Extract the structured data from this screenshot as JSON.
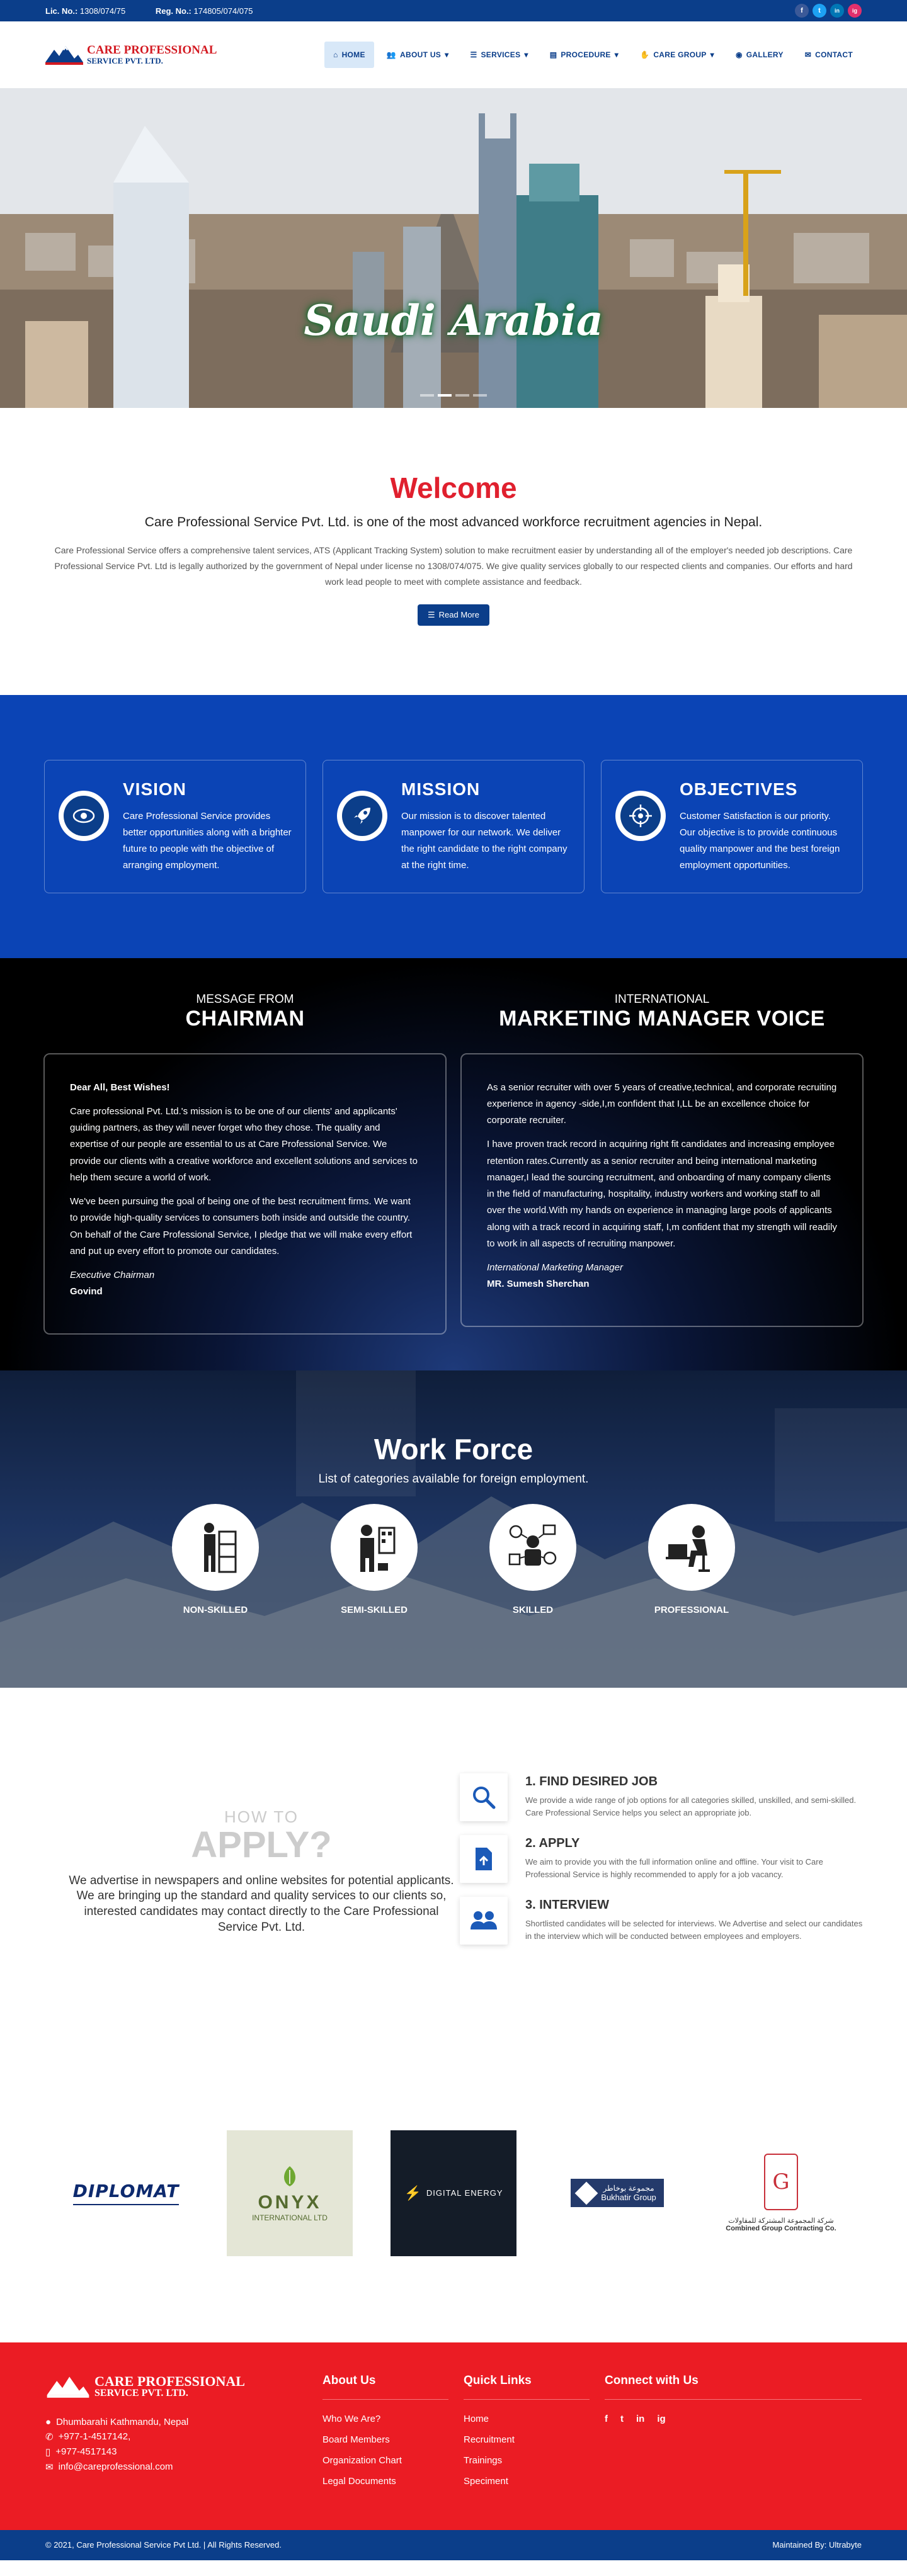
{
  "topbar": {
    "lic_label": "Lic. No.:",
    "lic_value": "1308/074/75",
    "reg_label": "Reg. No.:",
    "reg_value": "174805/074/075",
    "social": [
      "f",
      "t",
      "in",
      "ig"
    ]
  },
  "brand": {
    "line1": "CARE PROFESSIONAL",
    "line2": "SERVICE PVT. LTD."
  },
  "nav": {
    "items": [
      "HOME",
      "ABOUT US",
      "SERVICES",
      "PROCEDURE",
      "CARE GROUP",
      "GALLERY",
      "CONTACT"
    ]
  },
  "hero": {
    "caption": "Saudi Arabia"
  },
  "welcome": {
    "title": "Welcome",
    "subtitle": "Care Professional Service Pvt. Ltd. is one of the most advanced workforce recruitment agencies in Nepal.",
    "body": "Care Professional Service offers a comprehensive talent services, ATS (Applicant Tracking System) solution to make recruitment easier by understanding all of the employer's needed job descriptions. Care Professional Service Pvt. Ltd is legally authorized by the government of Nepal under license no 1308/074/075. We give quality services globally to our respected clients and companies. Our efforts and hard work lead people to meet with complete assistance and feedback.",
    "button": "Read More"
  },
  "vmo": [
    {
      "title": "VISION",
      "text": "Care Professional Service provides better opportunities along with a brighter future to people with the objective of arranging employment."
    },
    {
      "title": "MISSION",
      "text": "Our mission is to discover talented manpower for our network. We deliver the right candidate to the right company at the right time."
    },
    {
      "title": "OBJECTIVES",
      "text": "Customer Satisfaction is our priority. Our objective is to provide continuous quality manpower and the best foreign employment opportunities."
    }
  ],
  "chairman": {
    "small": "MESSAGE FROM",
    "big": "CHAIRMAN",
    "greeting": "Dear All, Best Wishes!",
    "p1": "Care professional Pvt. Ltd.'s mission is to be one of our clients' and applicants' guiding partners, as they will never forget who they chose. The quality and expertise of our people are essential to us at Care Professional Service. We provide our clients with a creative workforce and excellent solutions and services to help them secure a world of work.",
    "p2": "We've been pursuing the goal of being one of the best recruitment firms. We want to provide high-quality services to consumers both inside and outside the country. On behalf of the Care Professional Service, I pledge that we will make every effort and put up every effort to promote our candidates.",
    "role": "Executive Chairman",
    "name": "Govind"
  },
  "manager": {
    "small": "INTERNATIONAL",
    "big": "MARKETING MANAGER VOICE",
    "p1": "As a senior recruiter with over 5 years of creative,technical, and corporate recruiting experience in agency -side,I,m confident that I,LL be an excellence choice for corporate recruiter.",
    "p2": "I have proven track record in acquiring right fit candidates and increasing employee retention rates.Currently as a senior recruiter and being international marketing manager,I lead the sourcing recruitment, and onboarding of many company clients in the field of manufacturing, hospitality, industry workers and working staff to all over the world.With my hands on experience in managing large pools of applicants along with a track record in acquiring staff, I,m confident that my strength will readily to work in all aspects of recruiting manpower.",
    "role": "International Marketing Manager",
    "name": "MR. Sumesh Sherchan"
  },
  "workforce": {
    "title": "Work Force",
    "subtitle": "List of categories available for foreign employment.",
    "categories": [
      "NON-SKILLED",
      "SEMI-SKILLED",
      "SKILLED",
      "PROFESSIONAL"
    ]
  },
  "apply": {
    "how": "HOW TO",
    "big": "APPLY?",
    "text": "We advertise in newspapers and online websites for potential applicants. We are bringing up the standard and quality services to our clients so, interested candidates may contact directly to the Care Professional Service Pvt. Ltd.",
    "steps": [
      {
        "title": "1. FIND DESIRED JOB",
        "text": "We provide a wide range of job options for all categories skilled, unskilled, and semi-skilled. Care Professional Service helps you select an appropriate job."
      },
      {
        "title": "2. APPLY",
        "text": "We aim to provide you with the full information online and offline. Your visit to Care Professional Service is highly recommended to apply for a job vacancy."
      },
      {
        "title": "3. INTERVIEW",
        "text": "Shortlisted candidates will be selected for interviews. We Advertise and select our candidates in the interview which will be conducted between employees and employers."
      }
    ]
  },
  "partners": {
    "diplomat": "DIPLOMAT",
    "onyx1": "ONYX",
    "onyx2": "INTERNATIONAL LTD",
    "digital": "DIGITAL ENERGY",
    "bukhatir_ar": "مجموعة بوخاطر",
    "bukhatir": "Bukhatir Group",
    "combined_ar": "شركة المجموعة المشتركة للمقاولات",
    "combined": "Combined Group Contracting Co."
  },
  "footer": {
    "address": "Dhumbarahi Kathmandu, Nepal",
    "phone1": "+977-1-4517142,",
    "phone2": "+977-4517143",
    "email": "info@careprofessional.com",
    "about_title": "About Us",
    "about_links": [
      "Who We Are?",
      "Board Members",
      "Organization Chart",
      "Legal Documents"
    ],
    "quick_title": "Quick Links",
    "quick_links": [
      "Home",
      "Recruitment",
      "Trainings",
      "Speciment"
    ],
    "connect_title": "Connect with Us",
    "connect_social": [
      "f",
      "t",
      "in",
      "ig"
    ]
  },
  "bottom": {
    "copyright": "© 2021, Care Professional Service Pvt Ltd. | All Rights Reserved.",
    "maintained": "Maintained By: Ultrabyte"
  },
  "colors": {
    "primary": "#0b3e8a",
    "accent_red": "#e0202e",
    "vmo_blue": "#0b44b5",
    "footer_red": "#eb1c24"
  }
}
